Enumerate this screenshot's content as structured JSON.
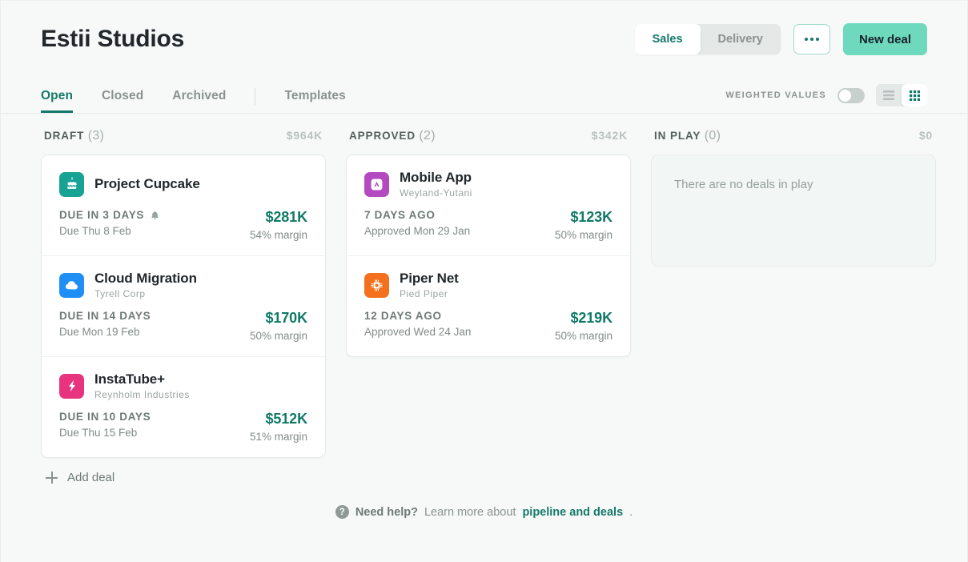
{
  "header": {
    "title": "Estii Studios",
    "segmented": {
      "options": [
        "Sales",
        "Delivery"
      ],
      "selected": "Sales"
    },
    "more_label": "•••",
    "new_deal_label": "New deal"
  },
  "tabs": {
    "items": [
      {
        "label": "Open",
        "active": true
      },
      {
        "label": "Closed",
        "active": false
      },
      {
        "label": "Archived",
        "active": false
      },
      {
        "label": "Templates",
        "active": false
      }
    ],
    "weighted_values_label": "WEIGHTED VALUES",
    "weighted_values_on": false,
    "view_mode": "grid",
    "view_options": [
      "list-view",
      "grid-view"
    ]
  },
  "columns": [
    {
      "title": "DRAFT",
      "count": "(3)",
      "total": "$964K",
      "empty_text": "",
      "deals": [
        {
          "name": "Project Cupcake",
          "company": "",
          "status": "DUE IN 3 DAYS",
          "has_bell": true,
          "date": "Due Thu 8 Feb",
          "value": "$281K",
          "margin": "54% margin",
          "icon": "cake-icon",
          "icon_color": "#17a394"
        },
        {
          "name": "Cloud Migration",
          "company": "Tyrell Corp",
          "status": "DUE IN 14 DAYS",
          "has_bell": false,
          "date": "Due Mon 19 Feb",
          "value": "$170K",
          "margin": "50% margin",
          "icon": "cloud-icon",
          "icon_color": "#1f8ff5"
        },
        {
          "name": "InstaTube+",
          "company": "Reynholm Industries",
          "status": "DUE IN 10 DAYS",
          "has_bell": false,
          "date": "Due Thu 15 Feb",
          "value": "$512K",
          "margin": "51% margin",
          "icon": "lightning-bolt-icon",
          "icon_color": "#e8337f"
        }
      ]
    },
    {
      "title": "APPROVED",
      "count": "(2)",
      "total": "$342K",
      "empty_text": "",
      "deals": [
        {
          "name": "Mobile App",
          "company": "Weyland-Yutani",
          "status": "7 DAYS AGO",
          "has_bell": false,
          "date": "Approved Mon 29 Jan",
          "value": "$123K",
          "margin": "50% margin",
          "icon": "app-store-icon",
          "icon_color": "#b44ac0"
        },
        {
          "name": "Piper Net",
          "company": "Pied Piper",
          "status": "12 DAYS AGO",
          "has_bell": false,
          "date": "Approved Wed 24 Jan",
          "value": "$219K",
          "margin": "50% margin",
          "icon": "chip-icon",
          "icon_color": "#f4701d"
        }
      ]
    },
    {
      "title": "IN PLAY",
      "count": "(0)",
      "total": "$0",
      "empty_text": "There are no deals in play",
      "deals": []
    }
  ],
  "add_deal_label": "Add deal",
  "footer": {
    "help_icon": "?",
    "need_help": "Need help?",
    "learn_more": "Learn more about",
    "link": "pipeline and deals",
    "period": "."
  },
  "colors": {
    "accent_teal": "#15796a",
    "brand_mint": "#6ed9bd",
    "value_green": "#0f7a66",
    "page_bg": "#f7f9f8"
  }
}
